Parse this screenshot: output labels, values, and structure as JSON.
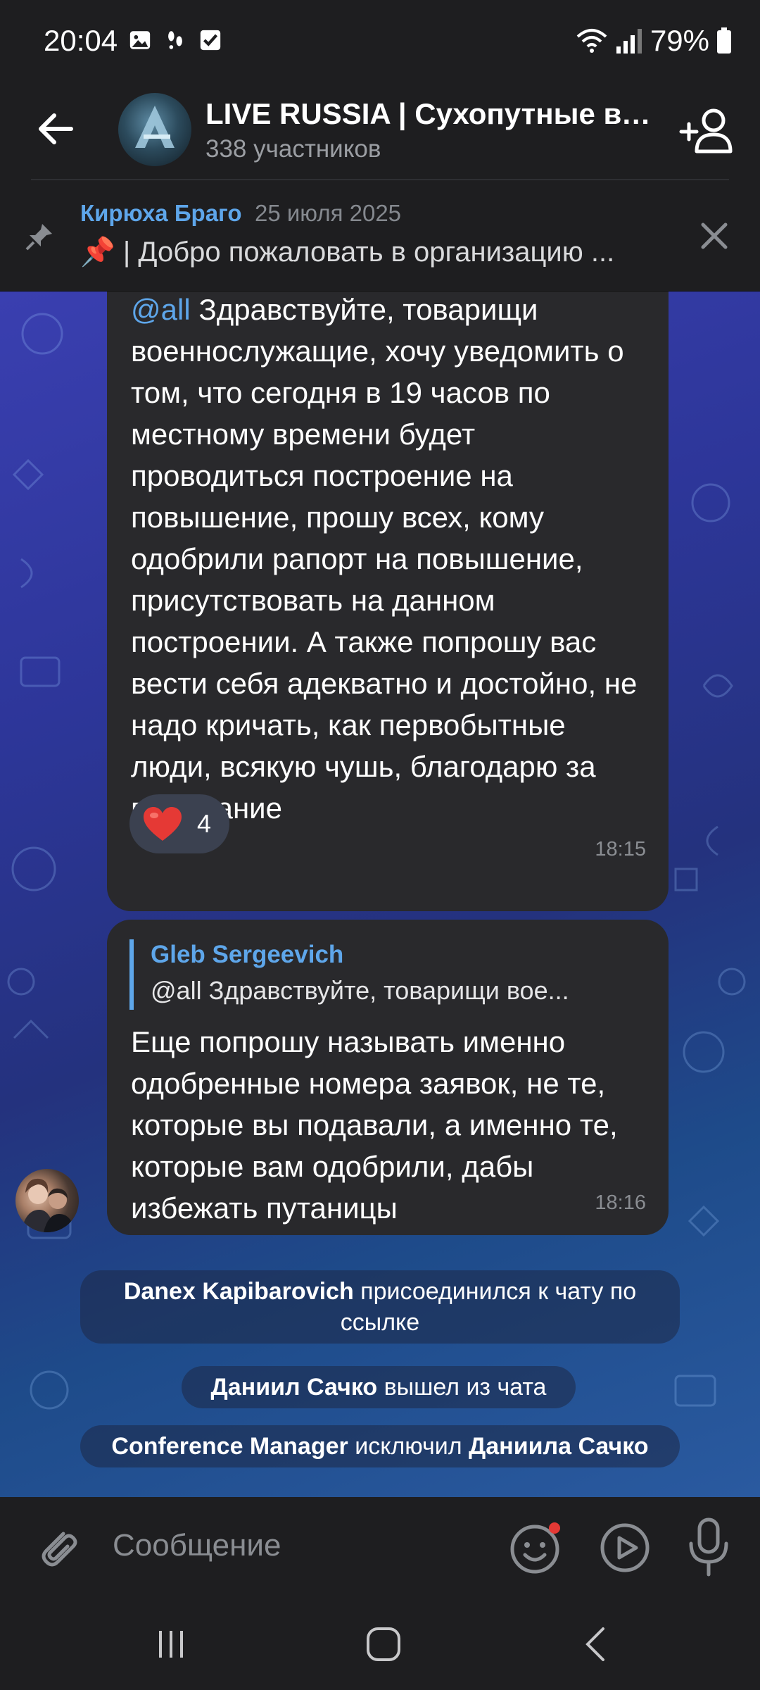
{
  "status_bar": {
    "time": "20:04",
    "battery": "79%",
    "icons": [
      "gallery-icon",
      "steps-icon",
      "check-icon",
      "wifi-icon",
      "signal-icon",
      "battery-icon"
    ]
  },
  "header": {
    "title": "LIVE RUSSIA | Сухопутные во...",
    "subtitle": "338 участников"
  },
  "pinned": {
    "author": "Кирюха Браго",
    "date": "25 июля 2025",
    "text": "📌 | Добро пожаловать в организацию ..."
  },
  "messages": [
    {
      "mention": "@all",
      "text": " Здравствуйте, товарищи военнослужащие, хочу уведомить о том, что сегодня в 19 часов по местному времени будет проводиться построение на повышение, прошу всех, кому одобрили рапорт на повышение, присутствовать на данном построении. А также попрошу вас вести себя адекватно и достойно, не надо кричать, как первобытные люди, всякую чушь, благодарю за понимание",
      "reaction_count": "4",
      "time": "18:15"
    },
    {
      "reply_author": "Gleb Sergeevich",
      "reply_text": "@all Здравствуйте, товарищи вое...",
      "text": "Еще попрошу называть именно одобренные номера заявок, не те, которые вы подавали, а именно те, которые вам одобрили, дабы избежать путаницы",
      "time": "18:16"
    }
  ],
  "service_messages": [
    {
      "actor": "Danex Kapibarovich",
      "action": " присоединился к чату по ссылке",
      "target": ""
    },
    {
      "actor": "Даниил Сачко",
      "action": " вышел из чата",
      "target": ""
    },
    {
      "actor": "Conference Manager",
      "action": " исключил ",
      "target": "Даниила Сачко"
    }
  ],
  "composer": {
    "placeholder": "Сообщение"
  },
  "colors": {
    "accent": "#5ea6ea",
    "bubble": "#29292c",
    "bar": "#1e1e20",
    "heart": "#e53935"
  }
}
